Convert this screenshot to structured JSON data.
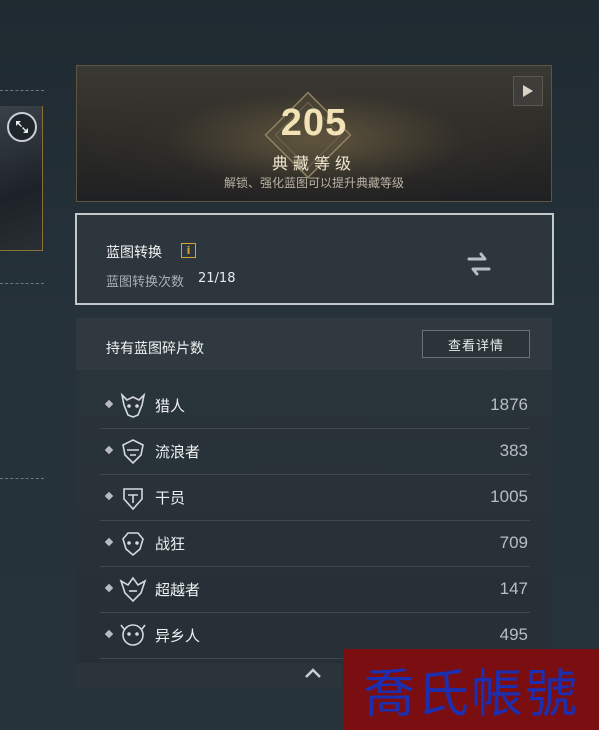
{
  "collection": {
    "level": "205",
    "title": "典藏等级",
    "description": "解锁、强化蓝图可以提升典藏等级"
  },
  "blueprint_conversion": {
    "title": "蓝图转换",
    "info_icon": "i",
    "count_label": "蓝图转换次数",
    "count_value": "21/18"
  },
  "fragments": {
    "title": "持有蓝图碎片数",
    "details_button": "查看详情",
    "items": [
      {
        "name": "猎人",
        "count": "1876",
        "icon": "hunter-class-icon"
      },
      {
        "name": "流浪者",
        "count": "383",
        "icon": "wanderer-class-icon"
      },
      {
        "name": "干员",
        "count": "1005",
        "icon": "operative-class-icon"
      },
      {
        "name": "战狂",
        "count": "709",
        "icon": "berserker-class-icon"
      },
      {
        "name": "超越者",
        "count": "147",
        "icon": "transcender-class-icon"
      },
      {
        "name": "异乡人",
        "count": "495",
        "icon": "outlander-class-icon"
      }
    ]
  },
  "watermark": "喬氏帳號",
  "colors": {
    "gold_text": "#f2e2b6",
    "info_accent": "#d6a230",
    "watermark_bg": "#7a0e10",
    "watermark_text": "#1c2fb0"
  }
}
